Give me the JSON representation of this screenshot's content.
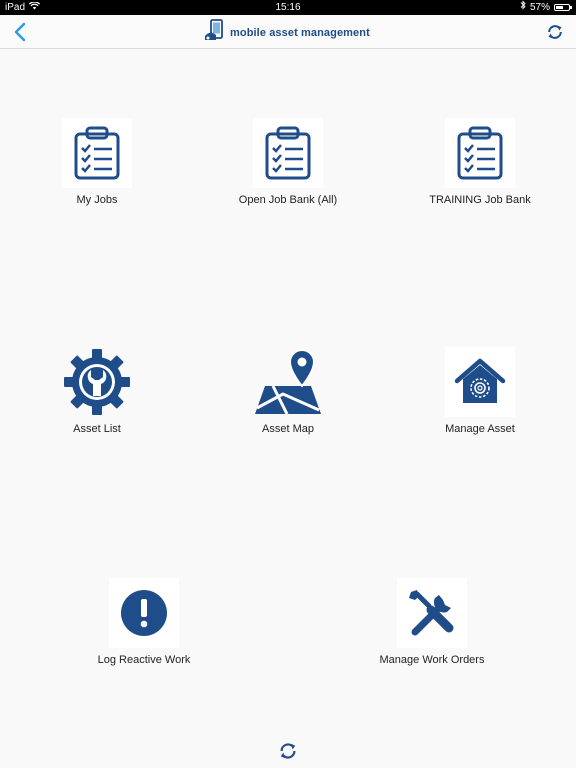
{
  "status_bar": {
    "device": "iPad",
    "time": "15:16",
    "battery": "57%",
    "battery_level": 0.57,
    "icons": [
      "wifi-icon",
      "bluetooth-icon",
      "battery-icon"
    ]
  },
  "header": {
    "title": "mobile asset management",
    "back_icon": "chevron-left-icon",
    "refresh_icon": "refresh-icon",
    "accent_color": "#2f9be0",
    "brand_color": "#1f4d8a"
  },
  "tiles": [
    {
      "label": "My Jobs",
      "icon": "clipboard-checklist-icon"
    },
    {
      "label": "Open Job Bank (All)",
      "icon": "clipboard-checklist-icon"
    },
    {
      "label": "TRAINING Job Bank",
      "icon": "clipboard-checklist-icon"
    },
    {
      "label": "Asset List",
      "icon": "gear-wrench-icon"
    },
    {
      "label": "Asset Map",
      "icon": "map-pin-icon"
    },
    {
      "label": "Manage Asset",
      "icon": "house-gear-icon"
    },
    {
      "label": "Log Reactive Work",
      "icon": "exclamation-circle-icon"
    },
    {
      "label": "Manage Work Orders",
      "icon": "tools-icon"
    }
  ],
  "footer": {
    "refresh_icon": "refresh-icon"
  },
  "colors": {
    "icon_blue": "#1f4d8a",
    "background": "#f9f9f9"
  }
}
